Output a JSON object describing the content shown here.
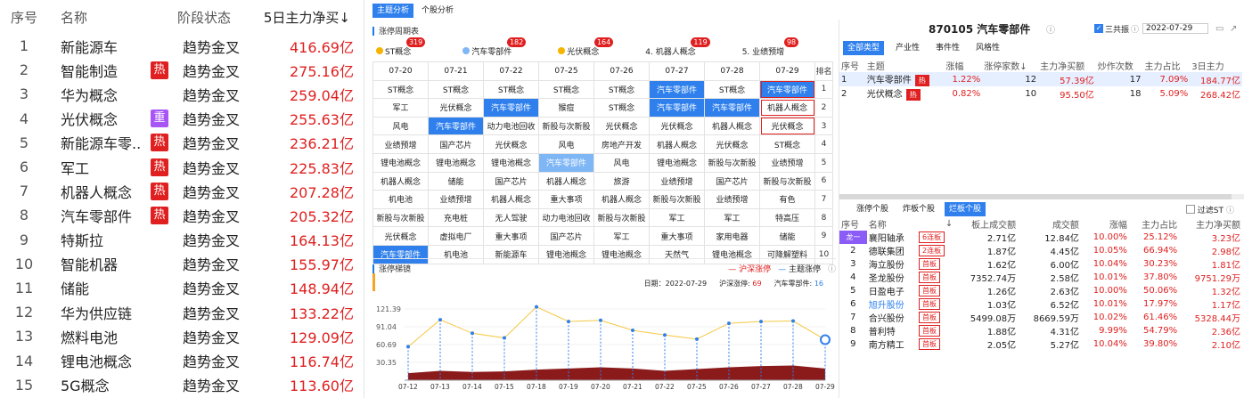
{
  "left": {
    "headers": [
      "序号",
      "名称",
      "阶段状态",
      "5日主力净买↓"
    ],
    "rows": [
      {
        "no": "1",
        "name": "新能源车",
        "badge": "",
        "stage": "趋势金叉",
        "val": "416.69亿"
      },
      {
        "no": "2",
        "name": "智能制造",
        "badge": "热",
        "stage": "趋势金叉",
        "val": "275.16亿"
      },
      {
        "no": "3",
        "name": "华为概念",
        "badge": "",
        "stage": "趋势金叉",
        "val": "259.04亿"
      },
      {
        "no": "4",
        "name": "光伏概念",
        "badge": "重",
        "stage": "趋势金叉",
        "val": "255.63亿"
      },
      {
        "no": "5",
        "name": "新能源车零...",
        "badge": "热",
        "stage": "趋势金叉",
        "val": "236.21亿"
      },
      {
        "no": "6",
        "name": "军工",
        "badge": "热",
        "stage": "趋势金叉",
        "val": "225.83亿"
      },
      {
        "no": "7",
        "name": "机器人概念",
        "badge": "热",
        "stage": "趋势金叉",
        "val": "207.28亿"
      },
      {
        "no": "8",
        "name": "汽车零部件",
        "badge": "热",
        "stage": "趋势金叉",
        "val": "205.32亿"
      },
      {
        "no": "9",
        "name": "特斯拉",
        "badge": "",
        "stage": "趋势金叉",
        "val": "164.13亿"
      },
      {
        "no": "10",
        "name": "智能机器",
        "badge": "",
        "stage": "趋势金叉",
        "val": "155.97亿"
      },
      {
        "no": "11",
        "name": "储能",
        "badge": "",
        "stage": "趋势金叉",
        "val": "148.94亿"
      },
      {
        "no": "12",
        "name": "华为供应链",
        "badge": "",
        "stage": "趋势金叉",
        "val": "133.22亿"
      },
      {
        "no": "13",
        "name": "燃料电池",
        "badge": "",
        "stage": "趋势金叉",
        "val": "129.09亿"
      },
      {
        "no": "14",
        "name": "锂电池概念",
        "badge": "",
        "stage": "趋势金叉",
        "val": "116.74亿"
      },
      {
        "no": "15",
        "name": "5G概念",
        "badge": "",
        "stage": "趋势金叉",
        "val": "113.60亿"
      }
    ]
  },
  "colors": {
    "hot": "#e02020",
    "zhong": "#a855f7",
    "accent": "#2f80ed"
  },
  "mid": {
    "tabs": [
      "主题分析",
      "个股分析"
    ],
    "cycle_title": "涨停周期表",
    "chips": [
      {
        "label": "ST概念",
        "n": "319",
        "dot": "#f5b400"
      },
      {
        "label": "汽车零部件",
        "n": "182",
        "dot": "#7fb6f5"
      },
      {
        "label": "光伏概念",
        "n": "164",
        "dot": "#f5b400"
      },
      {
        "label": "4. 机器人概念",
        "n": "119",
        "dot": ""
      },
      {
        "label": "5. 业绩预增",
        "n": "98",
        "dot": ""
      }
    ],
    "dates": [
      "07-20",
      "07-21",
      "07-22",
      "07-25",
      "07-26",
      "07-27",
      "07-28",
      "07-29"
    ],
    "rank_header": "排名",
    "grid": [
      [
        "ST概念",
        "ST概念",
        "ST概念",
        "ST概念",
        "ST概念",
        "汽车零部件",
        "ST概念",
        "汽车零部件"
      ],
      [
        "军工",
        "光伏概念",
        "汽车零部件",
        "猴痘",
        "ST概念",
        "汽车零部件",
        "汽车零部件",
        "机器人概念"
      ],
      [
        "风电",
        "汽车零部件",
        "动力电池回收",
        "新股与次新股",
        "光伏概念",
        "光伏概念",
        "机器人概念",
        "光伏概念"
      ],
      [
        "业绩预增",
        "国产芯片",
        "光伏概念",
        "风电",
        "房地产开发",
        "机器人概念",
        "光伏概念",
        "ST概念"
      ],
      [
        "锂电池概念",
        "锂电池概念",
        "锂电池概念",
        "汽车零部件",
        "风电",
        "锂电池概念",
        "新股与次新股",
        "业绩预增"
      ],
      [
        "机器人概念",
        "储能",
        "国产芯片",
        "机器人概念",
        "旅游",
        "业绩预增",
        "国产芯片",
        "新股与次新股"
      ],
      [
        "机电池",
        "业绩预增",
        "机器人概念",
        "重大事项",
        "机器人概念",
        "新股与次新股",
        "业绩预增",
        "有色"
      ],
      [
        "新股与次新股",
        "充电桩",
        "无人驾驶",
        "动力电池回收",
        "新股与次新股",
        "军工",
        "军工",
        "特高压"
      ],
      [
        "光伏概念",
        "虚拟电厂",
        "重大事项",
        "国产芯片",
        "军工",
        "重大事项",
        "家用电器",
        "储能"
      ],
      [
        "汽车零部件",
        "机电池",
        "新能源车",
        "锂电池概念",
        "锂电池概念",
        "天然气",
        "锂电池概念",
        "可降解塑料"
      ]
    ],
    "ranks": [
      "1",
      "2",
      "3",
      "4",
      "5",
      "6",
      "7",
      "8",
      "9",
      "10"
    ],
    "hl": [
      [
        0,
        5
      ],
      [
        0,
        7
      ],
      [
        1,
        2
      ],
      [
        1,
        5
      ],
      [
        1,
        6
      ],
      [
        2,
        1
      ],
      [
        9,
        0
      ]
    ],
    "lb": [
      [
        4,
        3
      ]
    ],
    "chart_title": "涨停梯镜",
    "legend1": "沪深涨停",
    "legend2": "主题涨停",
    "info": {
      "date": "日期：2022-07-29",
      "hs": "沪深涨停:",
      "hs_v": "69",
      "topic": "汽车零部件:",
      "topic_v": "16"
    }
  },
  "chart_data": {
    "type": "line",
    "title": "涨停梯镜",
    "x": [
      "07-12",
      "07-13",
      "07-14",
      "07-15",
      "07-18",
      "07-19",
      "07-20",
      "07-21",
      "07-22",
      "07-25",
      "07-26",
      "07-27",
      "07-28",
      "07-29"
    ],
    "yticks": [
      "121.39",
      "91.04",
      "60.69",
      "30.35"
    ],
    "ylim": [
      0,
      151.74
    ],
    "series": [
      {
        "name": "沪深涨停",
        "values": [
          12,
          16,
          14,
          15,
          18,
          20,
          22,
          20,
          16,
          19,
          22,
          24,
          25,
          20
        ]
      },
      {
        "name": "主题涨停",
        "values": [
          57,
          103,
          80,
          72,
          125,
          100,
          102,
          85,
          77,
          70,
          97,
          100,
          101,
          69
        ]
      }
    ]
  },
  "right": {
    "title": "870105 汽车零部件",
    "sanjia": "三共振",
    "date": "2022-07-29",
    "types": [
      "全部类型",
      "产业性",
      "事件性",
      "风格性"
    ],
    "thead": [
      "序号",
      "主题",
      "涨幅",
      "涨停家数↓",
      "主力净买额",
      "炒作次数",
      "主力占比",
      "3日主力"
    ],
    "trows": [
      {
        "no": "1",
        "name": "汽车零部件",
        "tag": "热",
        "zf": "1.22%",
        "zt": "12",
        "jm": "57.39亿",
        "cz": "17",
        "zb": "7.09%",
        "r3": "184.77亿"
      },
      {
        "no": "2",
        "name": "光伏概念",
        "tag": "热",
        "zf": "0.82%",
        "zt": "10",
        "jm": "95.50亿",
        "cz": "18",
        "zb": "5.09%",
        "r3": "268.42亿"
      }
    ],
    "btabs": [
      "涨停个股",
      "炸板个股",
      "烂板个股"
    ],
    "filter": "过滤ST",
    "shead": [
      "序号",
      "名称",
      "↓",
      "板上成交额",
      "成交额",
      "涨幅",
      "主力占比",
      "主力净买额"
    ],
    "stocks": [
      {
        "no": "龙一",
        "name": "襄阳轴承",
        "tag": "6连板",
        "bs": "2.71亿",
        "cj": "12.84亿",
        "zf": "10.00%",
        "zb": "25.12%",
        "jm": "3.23亿"
      },
      {
        "no": "2",
        "name": "德联集团",
        "tag": "2连板",
        "bs": "1.87亿",
        "cj": "4.45亿",
        "zf": "10.05%",
        "zb": "66.94%",
        "jm": "2.98亿"
      },
      {
        "no": "3",
        "name": "海立股份",
        "tag": "首板",
        "bs": "1.62亿",
        "cj": "6.00亿",
        "zf": "10.04%",
        "zb": "30.23%",
        "jm": "1.81亿"
      },
      {
        "no": "4",
        "name": "圣龙股份",
        "tag": "首板",
        "bs": "7352.74万",
        "cj": "2.58亿",
        "zf": "10.01%",
        "zb": "37.80%",
        "jm": "9751.29万"
      },
      {
        "no": "5",
        "name": "日盈电子",
        "tag": "首板",
        "bs": "1.26亿",
        "cj": "2.63亿",
        "zf": "10.00%",
        "zb": "50.06%",
        "jm": "1.32亿"
      },
      {
        "no": "6",
        "name": "旭升股份",
        "tag": "首板",
        "bs": "1.03亿",
        "cj": "6.52亿",
        "zf": "10.01%",
        "zb": "17.97%",
        "jm": "1.17亿"
      },
      {
        "no": "7",
        "name": "合兴股份",
        "tag": "首板",
        "bs": "5499.08万",
        "cj": "8669.59万",
        "zf": "10.02%",
        "zb": "61.46%",
        "jm": "5328.44万"
      },
      {
        "no": "8",
        "name": "普利特",
        "tag": "首板",
        "bs": "1.88亿",
        "cj": "4.31亿",
        "zf": "9.99%",
        "zb": "54.79%",
        "jm": "2.36亿"
      },
      {
        "no": "9",
        "name": "南方精工",
        "tag": "首板",
        "bs": "2.05亿",
        "cj": "5.27亿",
        "zf": "10.04%",
        "zb": "39.80%",
        "jm": "2.10亿"
      }
    ]
  }
}
